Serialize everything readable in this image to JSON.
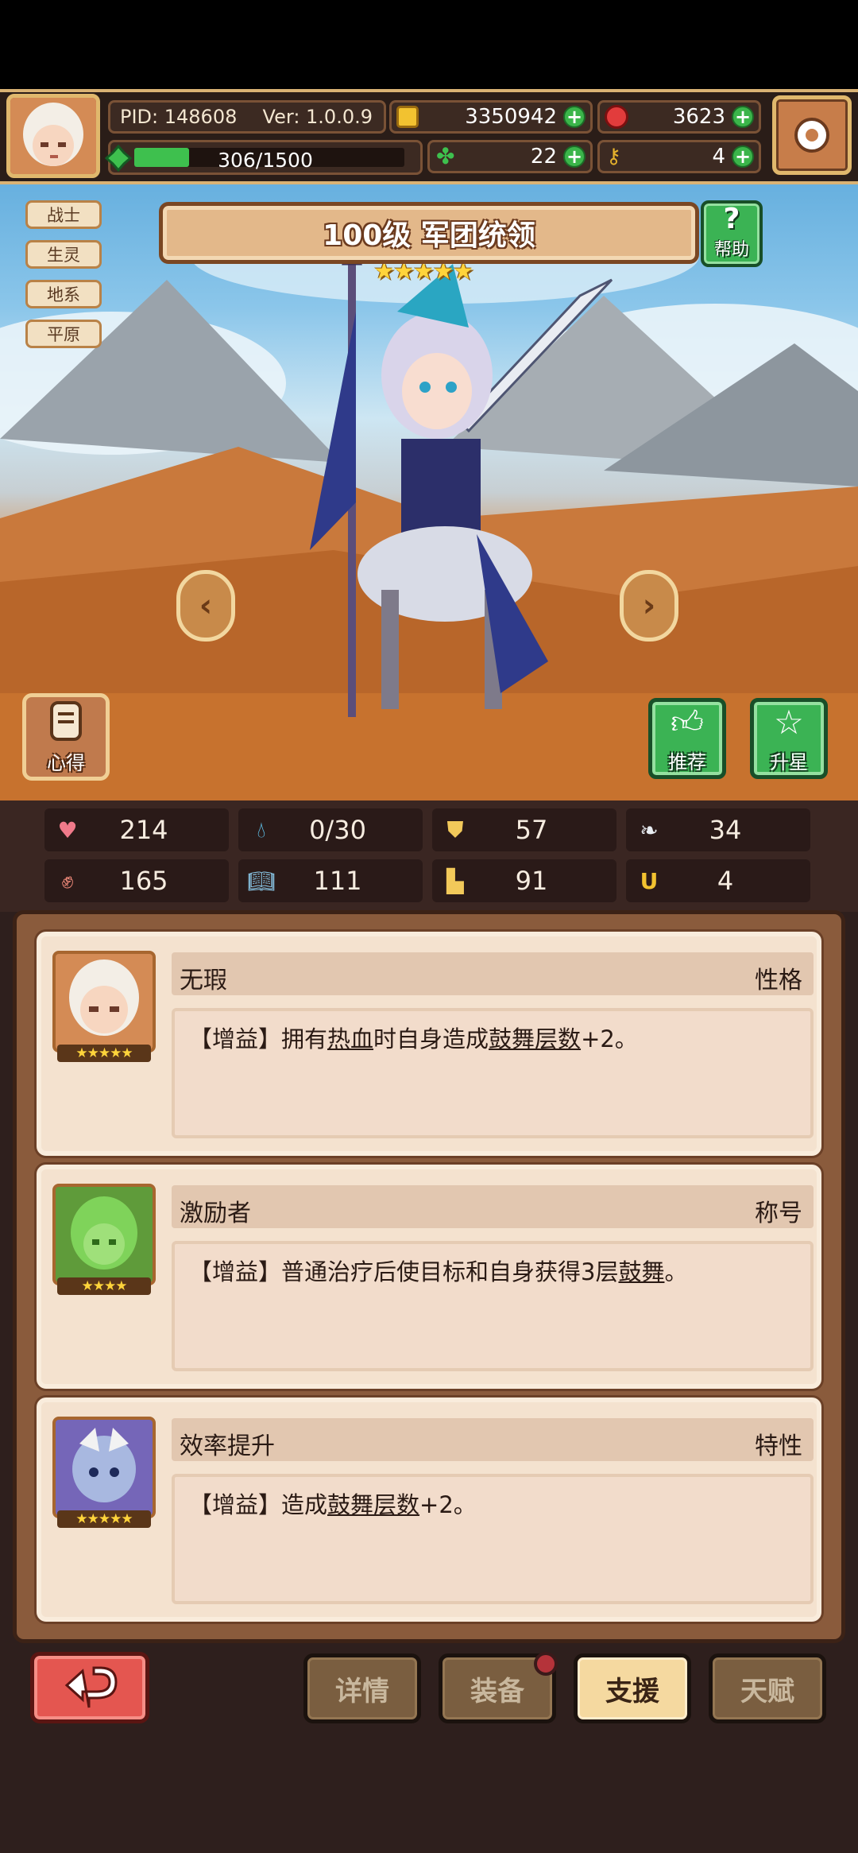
{
  "hud": {
    "pid": "PID: 148608",
    "version": "Ver: 1.0.0.9",
    "energy": "306/1500",
    "energy_fraction": 0.204,
    "gold": "3350942",
    "gems": "3623",
    "clover": "22",
    "keys": "4"
  },
  "hero": {
    "tags": [
      "战士",
      "生灵",
      "地系",
      "平原"
    ],
    "title": "100级 军团统领",
    "stars": "★★★★★",
    "help_label": "帮助",
    "notes_label": "心得",
    "recommend_label": "推荐",
    "star_up_label": "升星"
  },
  "stats": [
    {
      "icon": "heart-icon",
      "value": "214"
    },
    {
      "icon": "water-drop-icon",
      "value": "0/30"
    },
    {
      "icon": "shield-icon",
      "value": "57"
    },
    {
      "icon": "wing-icon",
      "value": "34"
    },
    {
      "icon": "fist-icon",
      "value": "165"
    },
    {
      "icon": "book-icon",
      "value": "111"
    },
    {
      "icon": "boot-icon",
      "value": "91"
    },
    {
      "icon": "horseshoe-icon",
      "value": "4"
    }
  ],
  "cards": [
    {
      "name": "无瑕",
      "type": "性格",
      "stars": "★★★★★",
      "text_parts": [
        "【增益】拥有",
        "热血",
        "时自身造成",
        "鼓舞层数",
        "+2。"
      ]
    },
    {
      "name": "激励者",
      "type": "称号",
      "stars": "★★★★",
      "text_parts": [
        "【增益】普通治疗后使目标和自身获得3层",
        "鼓舞",
        "。"
      ]
    },
    {
      "name": "效率提升",
      "type": "特性",
      "stars": "★★★★★",
      "text_parts": [
        "【增益】造成",
        "鼓舞层数",
        "+2。"
      ]
    }
  ],
  "nav": {
    "details": "详情",
    "equipment": "装备",
    "support": "支援",
    "talent": "天赋"
  },
  "colors": {
    "accent_gold": "#e0b86d",
    "panel_brown": "#8a5b3c",
    "green_button": "#3bb354",
    "red_button": "#e45650"
  }
}
